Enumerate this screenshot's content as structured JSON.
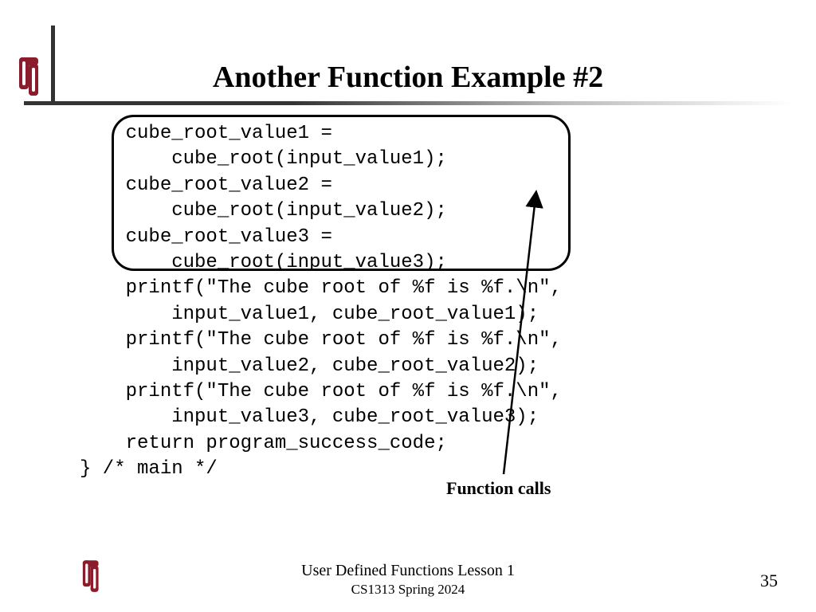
{
  "title": "Another Function Example #2",
  "code": {
    "l1": "    cube_root_value1 =",
    "l2": "        cube_root(input_value1);",
    "l3": "    cube_root_value2 =",
    "l4": "        cube_root(input_value2);",
    "l5": "    cube_root_value3 =",
    "l6": "        cube_root(input_value3);",
    "l7": "    printf(\"The cube root of %f is %f.\\n\",",
    "l8": "        input_value1, cube_root_value1);",
    "l9": "    printf(\"The cube root of %f is %f.\\n\",",
    "l10": "        input_value2, cube_root_value2);",
    "l11": "    printf(\"The cube root of %f is %f.\\n\",",
    "l12": "        input_value3, cube_root_value3);",
    "l13": "    return program_success_code;",
    "l14": "} /* main */"
  },
  "annotation": "Function calls",
  "footer": {
    "lesson": "User Defined Functions Lesson 1",
    "course": "CS1313 Spring 2024",
    "page": "35"
  },
  "logo_color": "#8a1c2b"
}
